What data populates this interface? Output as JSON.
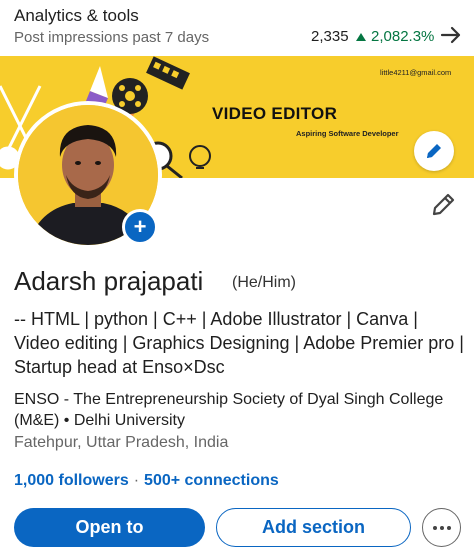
{
  "analytics": {
    "title": "Analytics & tools",
    "subtitle": "Post impressions past 7 days",
    "count": "2,335",
    "change": "2,082.3%",
    "change_color": "#057642",
    "arrow_icon": "arrow-right-icon"
  },
  "banner": {
    "title": "VIDEO EDITOR",
    "subtitle": "Aspiring Software Developer",
    "email": "little4211@gmail.com",
    "background_color": "#f7cd2c",
    "edit_icon": "pencil-icon"
  },
  "profile": {
    "name": "Adarsh prajapati",
    "pronouns": "(He/Him)",
    "headline": "-- HTML | python | C++ | Adobe Illustrator  | Canva | Video editing | Graphics Designing | Adobe Premier pro | Startup head at Enso×Dsc",
    "organization": "ENSO - The Entrepreneurship Society of Dyal Singh College (M&E) • Delhi University",
    "location": "Fatehpur, Uttar Pradesh, India",
    "followers": "1,000 followers",
    "separator": "·",
    "connections": "500+ connections",
    "add_photo_icon": "plus-icon",
    "edit_icon": "pencil-icon"
  },
  "actions": {
    "open_to": "Open to",
    "add_section": "Add section",
    "more_icon": "more-horizontal-icon"
  },
  "colors": {
    "accent": "#0a66c2",
    "secondary_text": "#666666"
  }
}
